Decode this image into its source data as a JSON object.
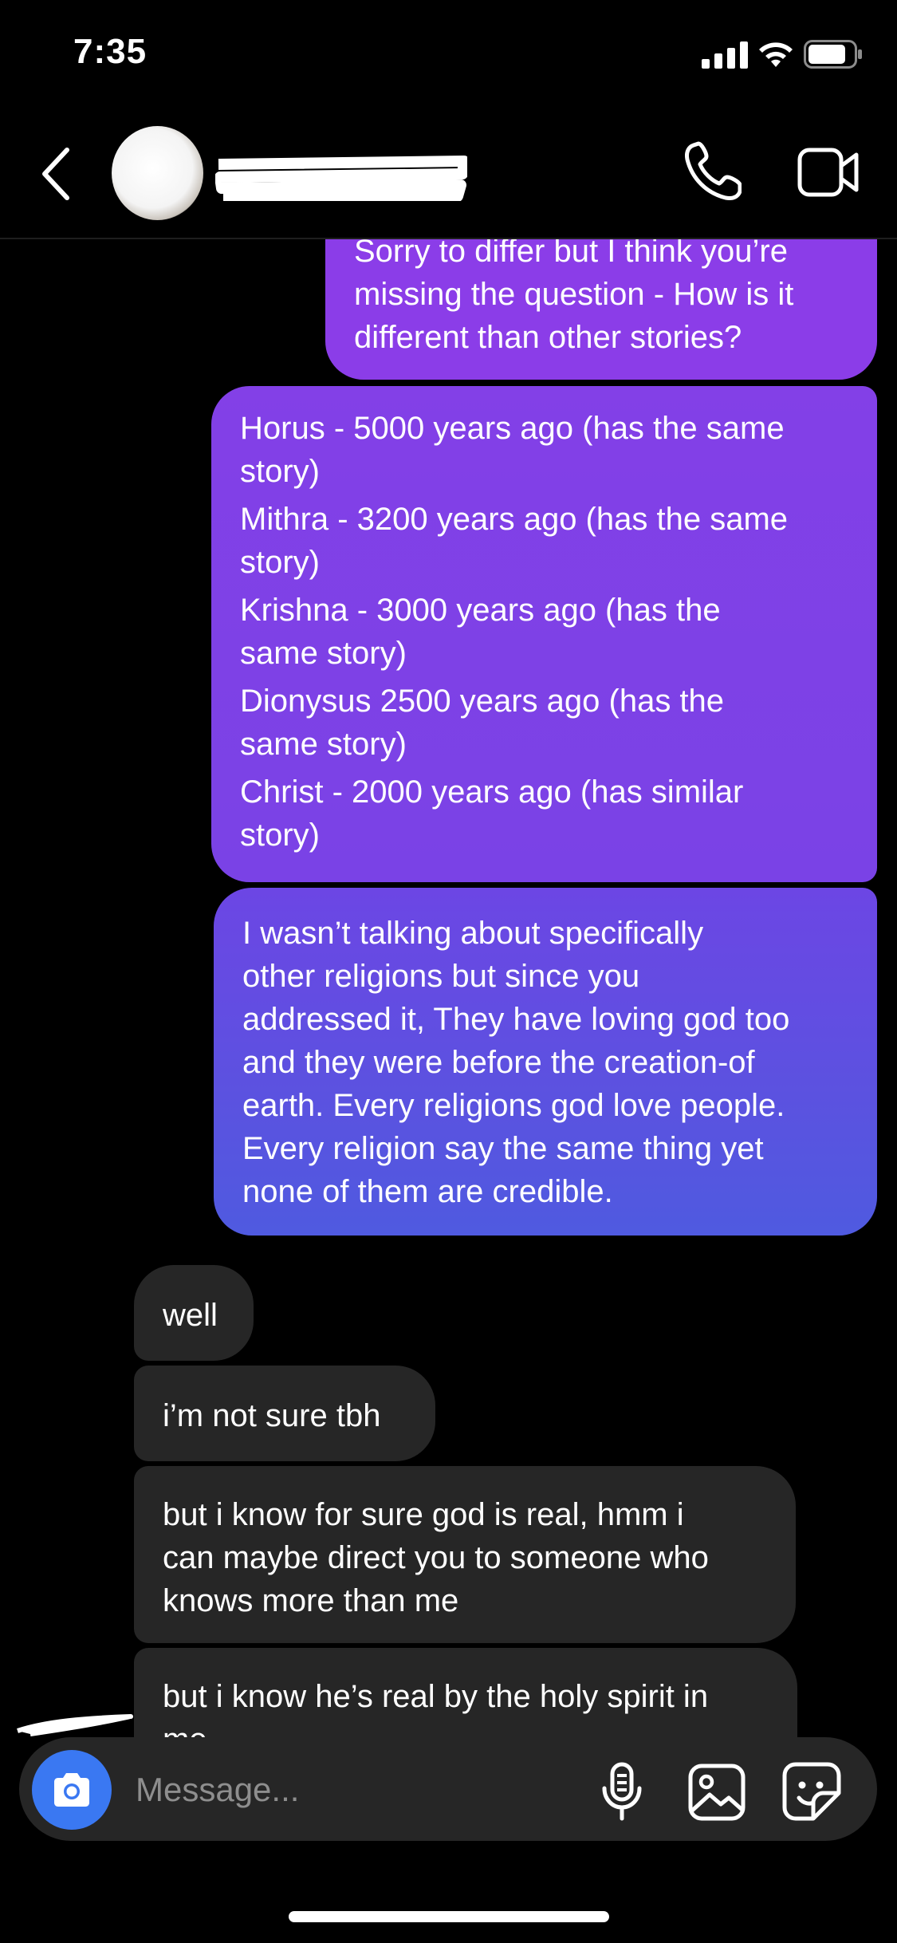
{
  "status_bar": {
    "time": "7:35"
  },
  "header": {
    "back_icon": "chevron-left-icon",
    "call_icon": "phone-icon",
    "video_icon": "video-camera-icon"
  },
  "messages": [
    {
      "direction": "sent",
      "lines": [
        "Sorry to differ but I think you’re",
        "missing the question - How is it",
        "different than other stories?"
      ]
    },
    {
      "direction": "sent",
      "lines": [
        "Horus - 5000 years ago (has the same",
        "story)",
        "Mithra - 3200 years ago (has the same",
        "story)",
        "Krishna - 3000 years ago (has the",
        "same story)",
        "Dionysus 2500 years ago (has the",
        "same story)",
        "Christ - 2000 years ago (has similar",
        "story)"
      ]
    },
    {
      "direction": "sent",
      "lines": [
        "I wasn’t talking about specifically",
        "other religions but since you",
        "addressed it, They have loving god too",
        "and they were before the creation-of",
        "earth. Every religions god love people.",
        "Every religion say the same thing yet",
        "none of them are credible."
      ]
    },
    {
      "direction": "received",
      "lines": [
        "well"
      ]
    },
    {
      "direction": "received",
      "lines": [
        "i’m not sure tbh"
      ]
    },
    {
      "direction": "received",
      "lines": [
        "but i know for sure god is real, hmm i",
        "can maybe direct you to someone who",
        "knows more than me"
      ]
    },
    {
      "direction": "received",
      "lines": [
        "but i know he’s real by the holy spirit in",
        "me"
      ]
    }
  ],
  "composer": {
    "placeholder": "Message...",
    "camera_icon": "camera-icon",
    "mic_icon": "microphone-icon",
    "gallery_icon": "image-gallery-icon",
    "sticker_icon": "sticker-icon"
  },
  "colors": {
    "background": "#000000",
    "sent_top": "#8b3de8",
    "sent_bottom": "#4f5ae0",
    "received_bubble": "#262626",
    "camera_button": "#3a78f2"
  }
}
